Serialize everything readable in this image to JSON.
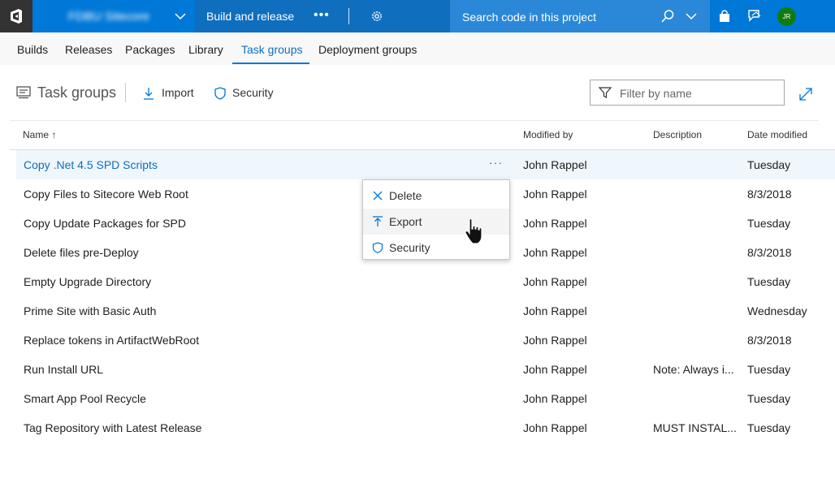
{
  "topbar": {
    "project_name": "FDBU Sitecore",
    "hub_title": "Build and release",
    "more_label": "•••",
    "search_placeholder": "Search code in this project",
    "avatar_initials": "JR"
  },
  "subnav": {
    "tabs": [
      {
        "label": "Builds"
      },
      {
        "label": "Releases"
      },
      {
        "label": "Packages"
      },
      {
        "label": "Library"
      },
      {
        "label": "Task groups",
        "active": true
      },
      {
        "label": "Deployment groups"
      }
    ]
  },
  "toolbar": {
    "title": "Task groups",
    "import_label": "Import",
    "security_label": "Security",
    "filter_placeholder": "Filter by name"
  },
  "table": {
    "columns": {
      "name": "Name ↑",
      "modified_by": "Modified by",
      "description": "Description",
      "date_modified": "Date modified"
    },
    "row_more": "···",
    "rows": [
      {
        "name": "Copy .Net 4.5 SPD Scripts",
        "modified_by": "John Rappel",
        "description": "",
        "date": "Tuesday"
      },
      {
        "name": "Copy Files to Sitecore Web Root",
        "modified_by": "John Rappel",
        "description": "",
        "date": "8/3/2018"
      },
      {
        "name": "Copy Update Packages for SPD",
        "modified_by": "John Rappel",
        "description": "",
        "date": "Tuesday"
      },
      {
        "name": "Delete files pre-Deploy",
        "modified_by": "John Rappel",
        "description": "",
        "date": "8/3/2018"
      },
      {
        "name": "Empty Upgrade Directory",
        "modified_by": "John Rappel",
        "description": "",
        "date": "Tuesday"
      },
      {
        "name": "Prime Site with Basic Auth",
        "modified_by": "John Rappel",
        "description": "",
        "date": "Wednesday"
      },
      {
        "name": "Replace tokens in ArtifactWebRoot",
        "modified_by": "John Rappel",
        "description": "",
        "date": "8/3/2018"
      },
      {
        "name": "Run Install URL",
        "modified_by": "John Rappel",
        "description": "Note: Always i...",
        "date": "Tuesday"
      },
      {
        "name": "Smart App Pool Recycle",
        "modified_by": "John Rappel",
        "description": "",
        "date": "Tuesday"
      },
      {
        "name": "Tag Repository with Latest Release",
        "modified_by": "John Rappel",
        "description": "MUST INSTAL...",
        "date": "Tuesday"
      }
    ]
  },
  "context_menu": {
    "items": [
      {
        "label": "Delete",
        "icon": "close-icon"
      },
      {
        "label": "Export",
        "icon": "upload-icon"
      },
      {
        "label": "Security",
        "icon": "shield-icon"
      }
    ]
  },
  "colors": {
    "accent": "#0078d7",
    "hub": "#106ebe",
    "search": "#2b88d8",
    "avatar": "#107c10",
    "selected_row": "#eff6fc"
  }
}
